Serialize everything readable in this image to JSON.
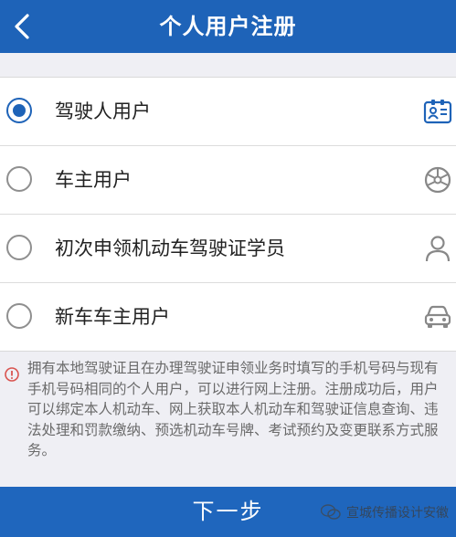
{
  "header": {
    "title": "个人用户注册",
    "back_icon": "chevron-left-icon"
  },
  "options": [
    {
      "label": "驾驶人用户",
      "selected": true,
      "icon": "id-card-icon"
    },
    {
      "label": "车主用户",
      "selected": false,
      "icon": "steering-wheel-icon"
    },
    {
      "label": "初次申领机动车驾驶证学员",
      "selected": false,
      "icon": "person-icon"
    },
    {
      "label": "新车车主用户",
      "selected": false,
      "icon": "car-front-icon"
    }
  ],
  "notice": {
    "icon": "info-icon",
    "text": "拥有本地驾驶证且在办理驾驶证申领业务时填写的手机号码与现有手机号码相同的个人用户，可以进行网上注册。注册成功后，用户可以绑定本人机动车、网上获取本人机动车和驾驶证信息查询、违法处理和罚款缴纳、预选机动车号牌、考试预约及变更联系方式服务。"
  },
  "footer": {
    "next_label": "下一步",
    "watermark_text": "宣城传播设计安徽"
  },
  "colors": {
    "primary": "#1e63b8",
    "notice_icon": "#d9534f",
    "background": "#efeff4"
  }
}
